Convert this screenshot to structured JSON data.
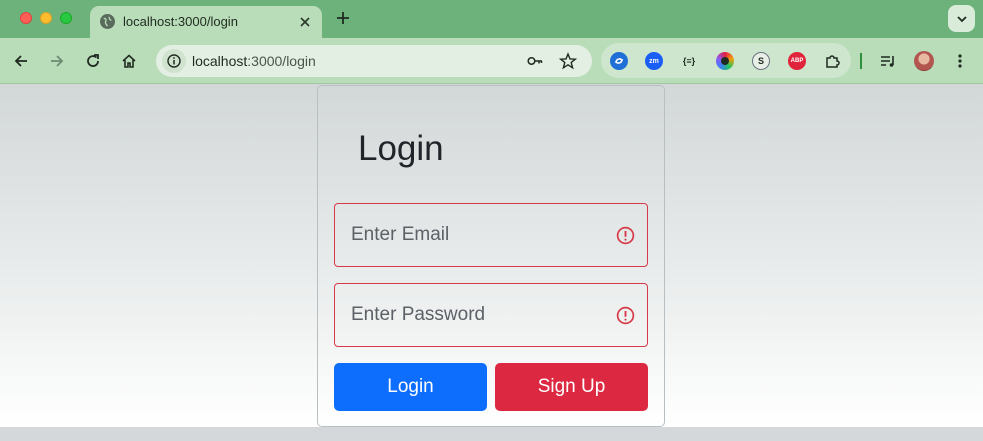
{
  "browser": {
    "tab": {
      "title": "localhost:3000/login"
    },
    "url": {
      "host": "localhost",
      "path": ":3000/login"
    },
    "extensions": [
      {
        "name": "sync-icon",
        "color": "#1f6fd6",
        "label": ""
      },
      {
        "name": "zm-icon",
        "color": "#1a5ef5",
        "label": "zm"
      },
      {
        "name": "json-icon",
        "color": "#cde6cd",
        "label": "{≡}"
      },
      {
        "name": "color-picker-icon",
        "color": "#7c3aed",
        "label": ""
      },
      {
        "name": "seo-icon",
        "color": "#e7efe7",
        "label": "S"
      },
      {
        "name": "adblock-icon",
        "color": "#e0243b",
        "label": "ABP"
      },
      {
        "name": "puzzle-icon",
        "color": "#cde6cd",
        "label": ""
      }
    ]
  },
  "login": {
    "title": "Login",
    "email_placeholder": "Enter Email",
    "password_placeholder": "Enter Password",
    "login_label": "Login",
    "signup_label": "Sign Up"
  },
  "colors": {
    "primary": "#0d6efd",
    "danger": "#dc2841",
    "invalid_border": "#d63a48"
  }
}
